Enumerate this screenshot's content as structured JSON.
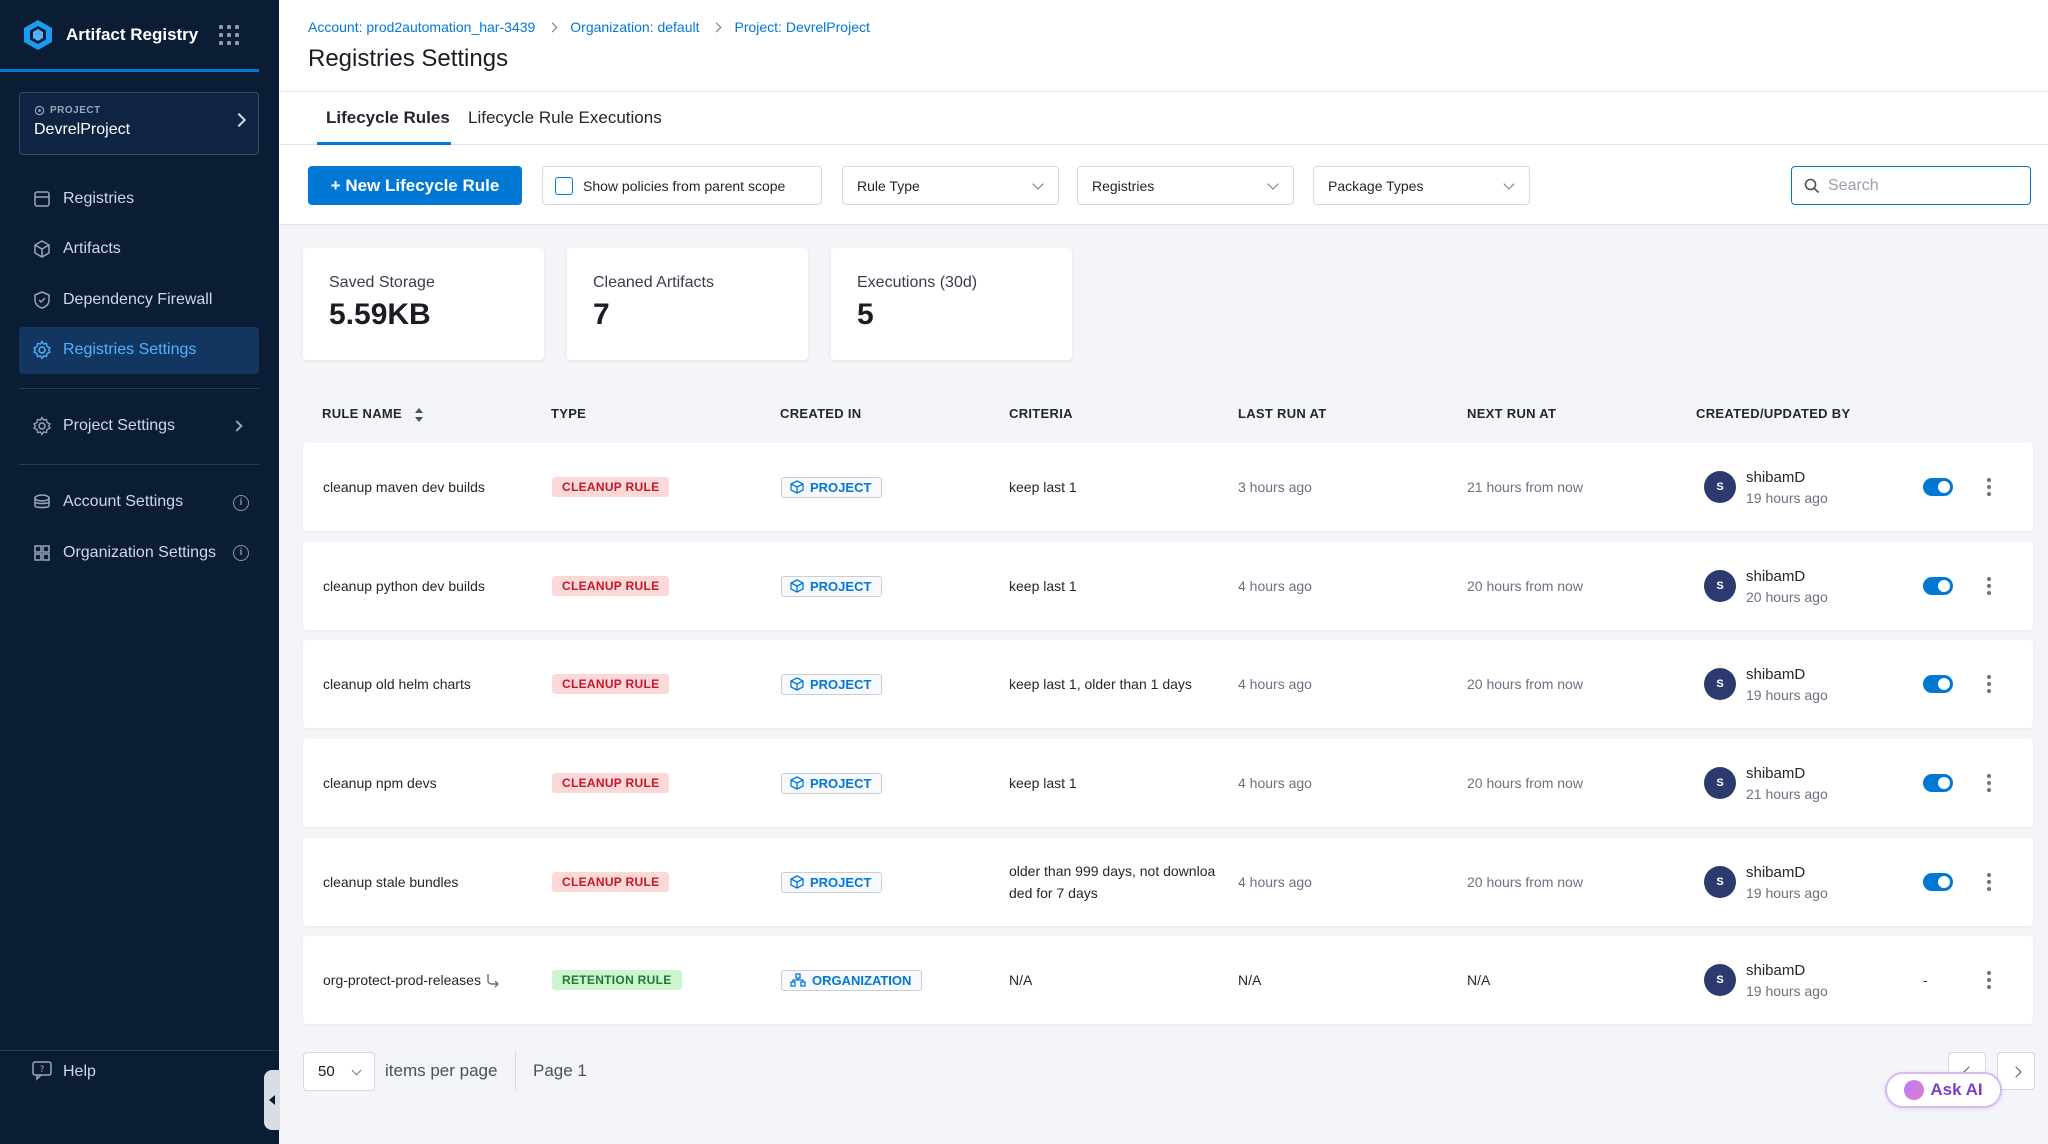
{
  "app": {
    "title": "Artifact Registry"
  },
  "sidebar": {
    "project_label": "PROJECT",
    "project_name": "DevrelProject",
    "items": [
      {
        "label": "Registries",
        "icon": "registries-icon"
      },
      {
        "label": "Artifacts",
        "icon": "artifacts-icon"
      },
      {
        "label": "Dependency Firewall",
        "icon": "shield-icon"
      },
      {
        "label": "Registries Settings",
        "icon": "gear-icon",
        "active": true
      }
    ],
    "project_settings": "Project Settings",
    "account_settings": "Account Settings",
    "organization_settings": "Organization Settings",
    "help": "Help"
  },
  "header": {
    "breadcrumb": [
      "Account: prod2automation_har-3439",
      "Organization: default",
      "Project: DevrelProject"
    ],
    "title": "Registries Settings"
  },
  "tabs": [
    {
      "label": "Lifecycle Rules",
      "active": true
    },
    {
      "label": "Lifecycle Rule Executions",
      "active": false
    }
  ],
  "toolbar": {
    "new_rule": "+ New Lifecycle Rule",
    "show_parent": "Show policies from parent scope",
    "rule_type": "Rule Type",
    "registries": "Registries",
    "package_types": "Package Types",
    "search_placeholder": "Search"
  },
  "stats": [
    {
      "label": "Saved Storage",
      "value": "5.59KB"
    },
    {
      "label": "Cleaned Artifacts",
      "value": "7"
    },
    {
      "label": "Executions (30d)",
      "value": "5"
    }
  ],
  "table": {
    "columns": [
      "RULE NAME",
      "TYPE",
      "CREATED IN",
      "CRITERIA",
      "LAST RUN AT",
      "NEXT RUN AT",
      "CREATED/UPDATED BY"
    ],
    "rows": [
      {
        "name": "cleanup maven dev builds",
        "type": "CLEANUP RULE",
        "created_in": "PROJECT",
        "criteria_1": "keep last 1",
        "criteria_2": "",
        "last_run": "3 hours ago",
        "next_run": "21 hours from now",
        "avatar": "S",
        "user": "shibamD",
        "updated": "19 hours ago",
        "toggle": true
      },
      {
        "name": "cleanup python dev builds",
        "type": "CLEANUP RULE",
        "created_in": "PROJECT",
        "criteria_1": "keep last 1",
        "criteria_2": "",
        "last_run": "4 hours ago",
        "next_run": "20 hours from now",
        "avatar": "S",
        "user": "shibamD",
        "updated": "20 hours ago",
        "toggle": true
      },
      {
        "name": "cleanup old helm charts",
        "type": "CLEANUP RULE",
        "created_in": "PROJECT",
        "criteria_1": "keep last 1, older than 1 days",
        "criteria_2": "",
        "last_run": "4 hours ago",
        "next_run": "20 hours from now",
        "avatar": "S",
        "user": "shibamD",
        "updated": "19 hours ago",
        "toggle": true
      },
      {
        "name": "cleanup npm devs",
        "type": "CLEANUP RULE",
        "created_in": "PROJECT",
        "criteria_1": "keep last 1",
        "criteria_2": "",
        "last_run": "4 hours ago",
        "next_run": "20 hours from now",
        "avatar": "S",
        "user": "shibamD",
        "updated": "21 hours ago",
        "toggle": true
      },
      {
        "name": "cleanup stale bundles",
        "type": "CLEANUP RULE",
        "created_in": "PROJECT",
        "criteria_1": "older than 999 days, not downloa",
        "criteria_2": "ded for 7 days",
        "last_run": "4 hours ago",
        "next_run": "20 hours from now",
        "avatar": "S",
        "user": "shibamD",
        "updated": "19 hours ago",
        "toggle": true
      },
      {
        "name": "org-protect-prod-releases",
        "type": "RETENTION RULE",
        "created_in": "ORGANIZATION",
        "criteria_1": "N/A",
        "criteria_2": "",
        "last_run": "N/A",
        "next_run": "N/A",
        "avatar": "S",
        "user": "shibamD",
        "updated": "19 hours ago",
        "toggle": false,
        "toggle_text": "-"
      }
    ]
  },
  "pagination": {
    "per_page": "50",
    "per_page_label": "items per page",
    "page_label": "Page 1"
  },
  "ask_ai": "Ask AI",
  "colors": {
    "accent": "#0278d5",
    "sidebar": "#0b1c35"
  }
}
